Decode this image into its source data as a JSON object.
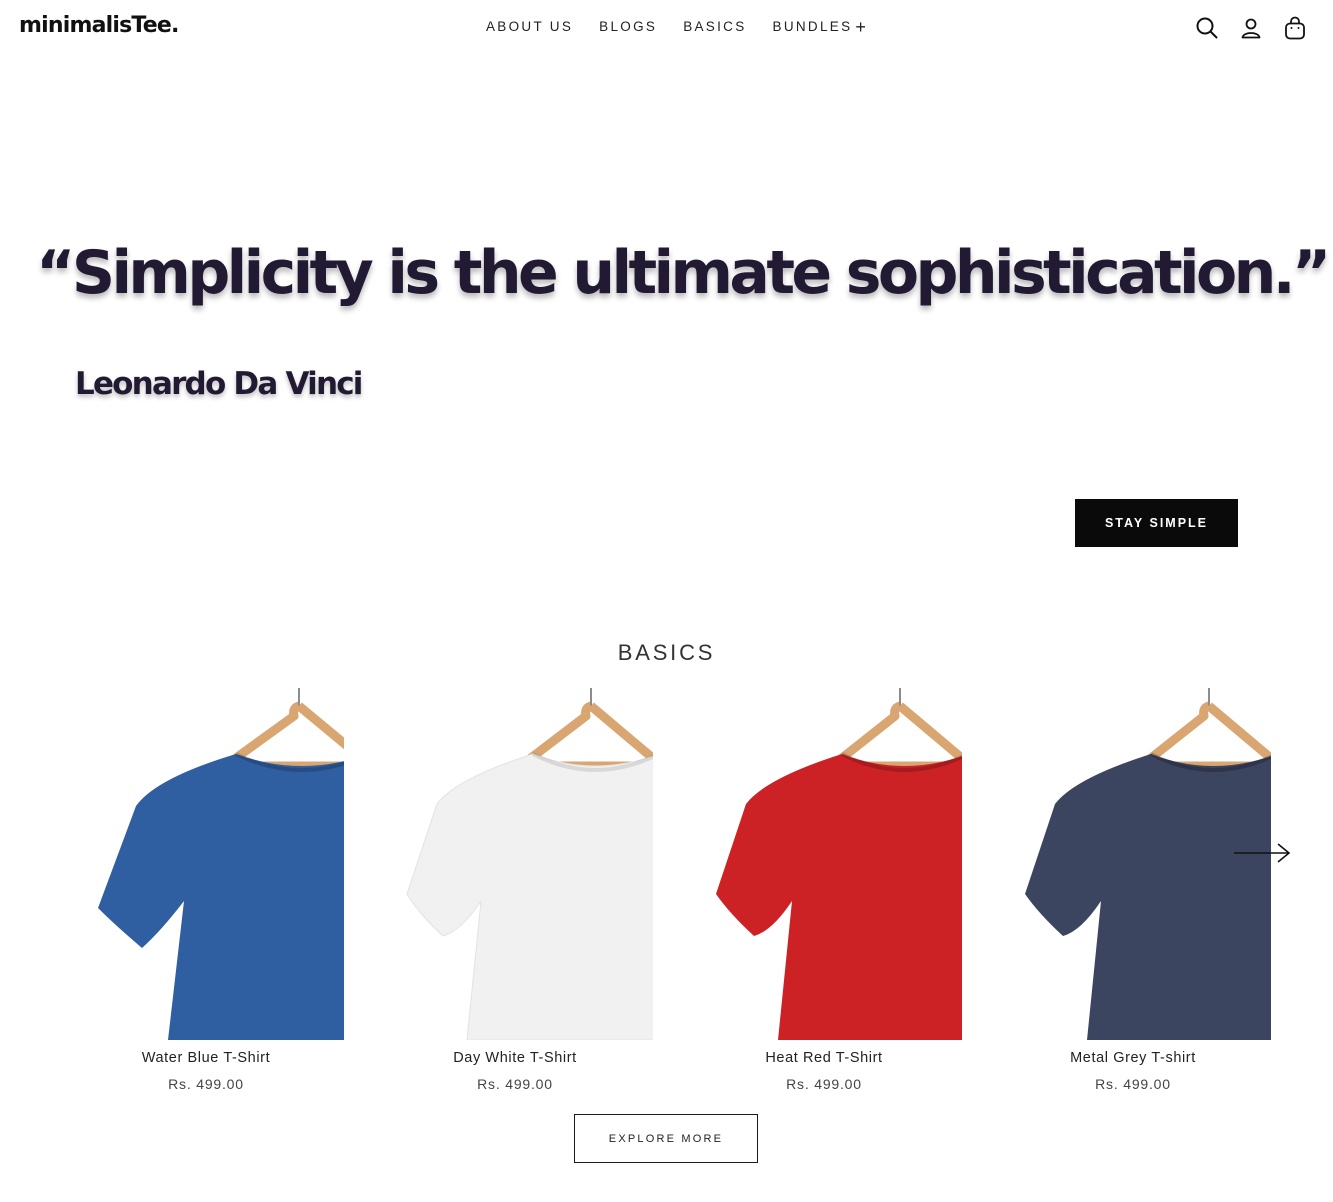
{
  "header": {
    "logo": "minimalisTee.",
    "nav": [
      {
        "label": "ABOUT US"
      },
      {
        "label": "BLOGS"
      },
      {
        "label": "BASICS"
      },
      {
        "label": "BUNDLES",
        "suffix": "+"
      }
    ],
    "icons": [
      "search-icon",
      "account-icon",
      "cart-icon"
    ]
  },
  "hero": {
    "quote": "“Simplicity is the ultimate sophistication.”",
    "author": "Leonardo Da Vinci",
    "cta_label": "STAY SIMPLE"
  },
  "basics": {
    "title": "BASICS",
    "products": [
      {
        "name": "Water Blue T-Shirt",
        "price": "Rs. 499.00",
        "color": "#2f5fa0"
      },
      {
        "name": "Day White T-Shirt",
        "price": "Rs. 499.00",
        "color": "#f1f1f1"
      },
      {
        "name": "Heat Red T-Shirt",
        "price": "Rs. 499.00",
        "color": "#cc2226"
      },
      {
        "name": "Metal Grey T-shirt",
        "price": "Rs. 499.00",
        "color": "#3c455f"
      }
    ],
    "next_icon": "arrow-right-icon",
    "explore_label": "EXPLORE MORE"
  }
}
